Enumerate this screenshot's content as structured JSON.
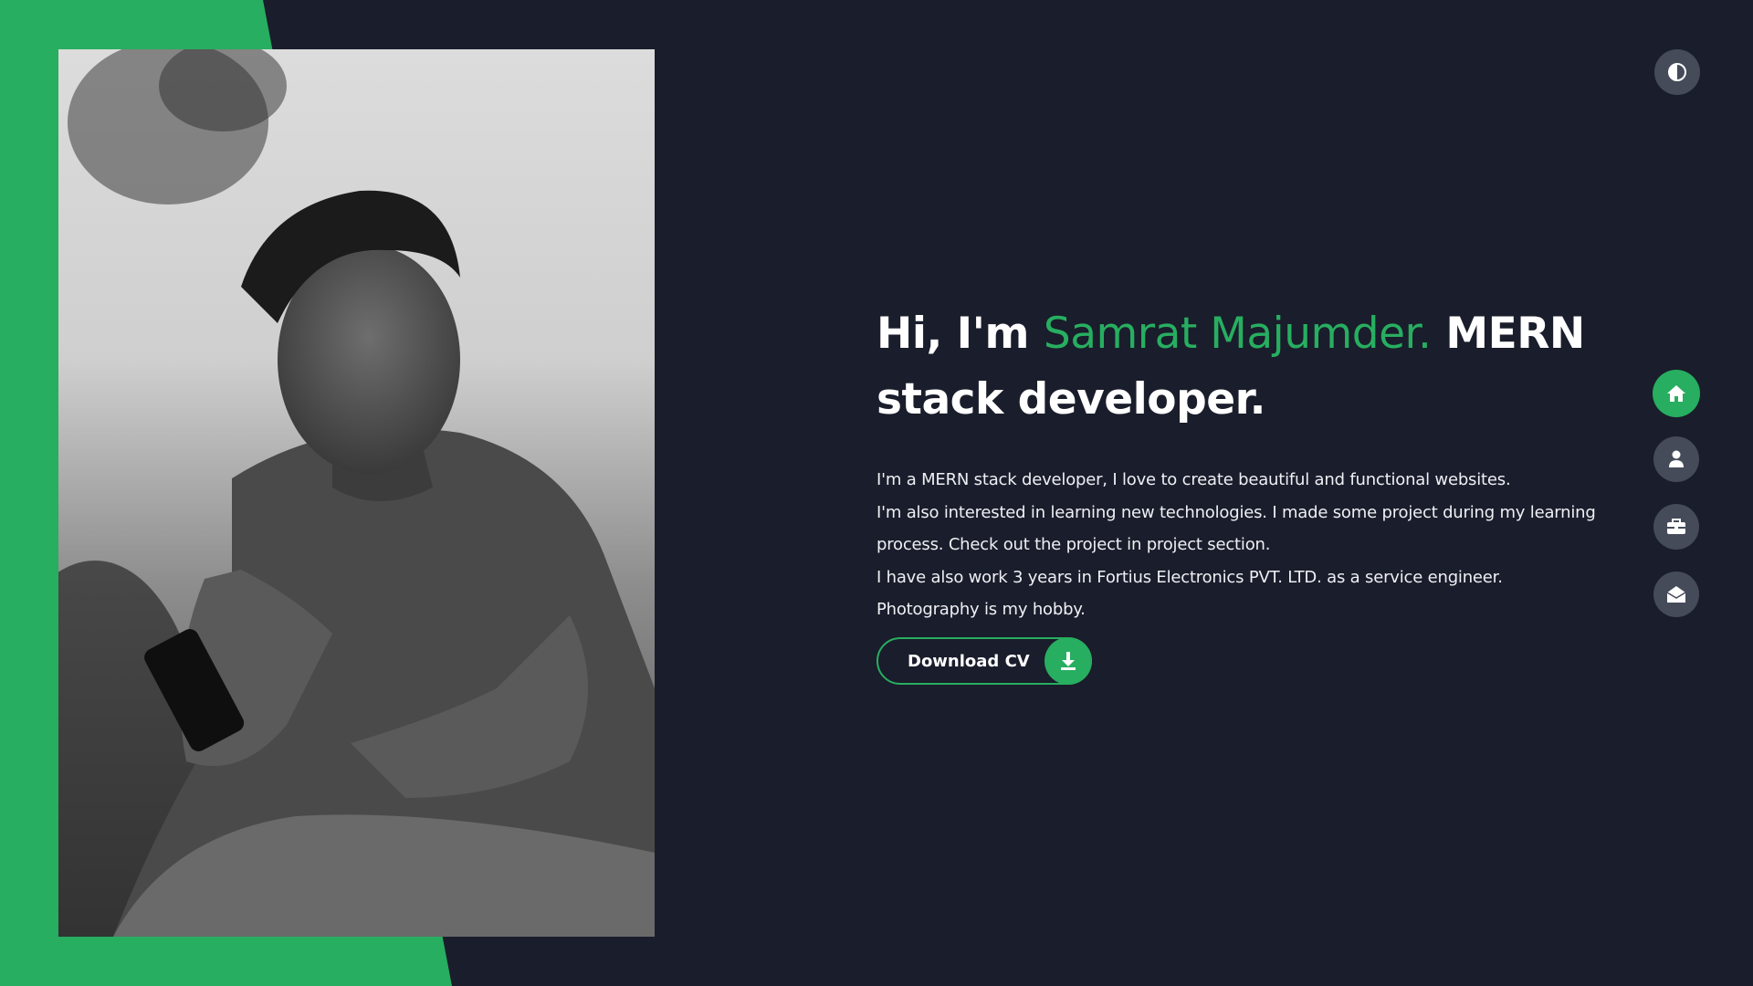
{
  "hero": {
    "greeting": "Hi, I'm ",
    "name": "Samrat Majumder.",
    "role_line1": " MERN",
    "role_line2": "stack developer.",
    "bio": [
      "I'm a MERN stack developer, I love to create beautiful and functional websites.",
      "I'm also interested in learning new technologies. I made some project during my learning",
      "process. Check out the project in project section.",
      "I have also work 3 years in Fortius Electronics PVT. LTD. as a service engineer.",
      "Photography is my hobby."
    ]
  },
  "actions": {
    "download_cv_label": "Download CV",
    "download_icon": "download-icon"
  },
  "nav": {
    "theme_toggle_icon": "contrast-icon",
    "items": [
      {
        "icon": "home-icon",
        "active": true
      },
      {
        "icon": "user-icon",
        "active": false
      },
      {
        "icon": "briefcase-icon",
        "active": false
      },
      {
        "icon": "envelope-open-icon",
        "active": false
      }
    ]
  },
  "portrait": {
    "description_icon": "profile-photo"
  },
  "colors": {
    "background": "#1a1d2b",
    "accent": "#27ae60",
    "nav_button": "#454b59",
    "text": "#ffffff"
  }
}
